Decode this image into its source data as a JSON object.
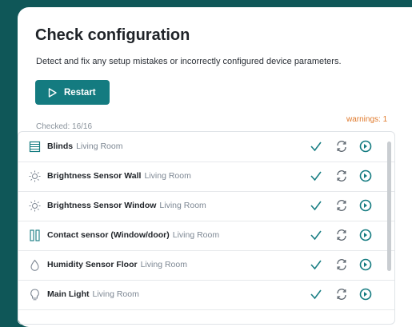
{
  "dialog": {
    "title": "Check configuration",
    "description": "Detect and fix any setup mistakes or incorrectly configured device parameters.",
    "restart_label": "Restart",
    "checked_label": "Checked: 16/16",
    "warnings_label": "warnings: 1"
  },
  "colors": {
    "background": "#0f5758",
    "accent": "#147b80",
    "ok": "#1a7f84",
    "warning": "#e07a2c"
  },
  "devices": [
    {
      "name": "Blinds",
      "room": "Living Room",
      "icon": "blinds-icon"
    },
    {
      "name": "Brightness Sensor Wall",
      "room": "Living Room",
      "icon": "sun-icon"
    },
    {
      "name": "Brightness Sensor Window",
      "room": "Living Room",
      "icon": "sun-icon"
    },
    {
      "name": "Contact sensor (Window/door)",
      "room": "Living Room",
      "icon": "window-icon"
    },
    {
      "name": "Humidity Sensor Floor",
      "room": "Living Room",
      "icon": "droplet-icon"
    },
    {
      "name": "Main Light",
      "room": "Living Room",
      "icon": "bulb-icon"
    }
  ]
}
